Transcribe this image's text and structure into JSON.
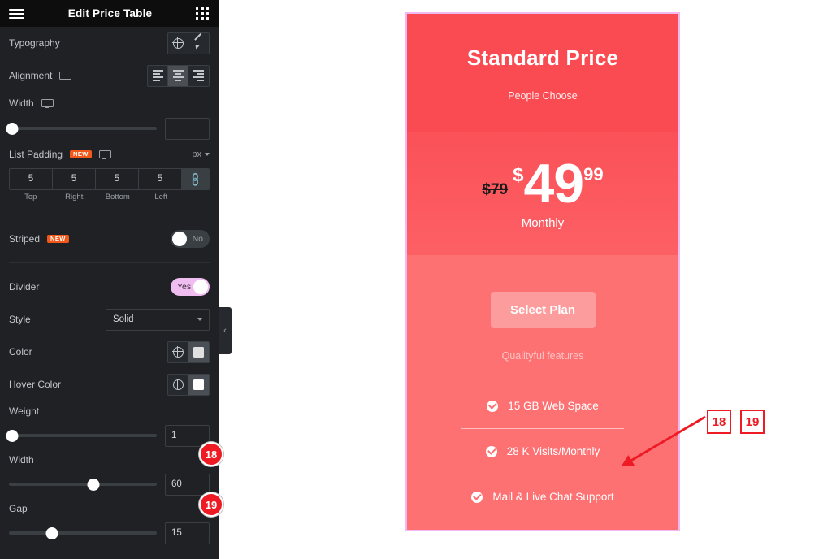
{
  "panel": {
    "header": {
      "title": "Edit Price Table",
      "menu_icon": "hamburger-icon",
      "apps_icon": "grid-dots-icon"
    },
    "typography": {
      "label": "Typography",
      "globe_icon": "globe-icon",
      "edit_icon": "pencil-icon"
    },
    "alignment": {
      "label": "Alignment",
      "device_icon": "desktop-icon",
      "options": [
        "align-left",
        "align-center",
        "align-right"
      ],
      "selected": "align-center"
    },
    "width": {
      "label": "Width",
      "device_icon": "desktop-icon",
      "value": "",
      "slider_percent": 0
    },
    "list_padding": {
      "label": "List Padding",
      "badge": "NEW",
      "device_icon": "desktop-icon",
      "unit": "px",
      "values": [
        "5",
        "5",
        "5",
        "5"
      ],
      "labels": [
        "Top",
        "Right",
        "Bottom",
        "Left"
      ],
      "link_icon": "link-icon",
      "linked": true
    },
    "striped": {
      "label": "Striped",
      "badge": "NEW",
      "state": "No",
      "on": false
    },
    "divider_toggle": {
      "label": "Divider",
      "state": "Yes",
      "on": true
    },
    "style": {
      "label": "Style",
      "value": "Solid",
      "caret_icon": "chevron-down-icon"
    },
    "color": {
      "label": "Color",
      "globe_icon": "globe-icon",
      "swatch": "#e0e0e0"
    },
    "hover_color": {
      "label": "Hover Color",
      "globe_icon": "globe-icon",
      "swatch": "#ffffff"
    },
    "weight": {
      "label": "Weight",
      "value": "1",
      "slider_percent": 0
    },
    "divider_width": {
      "label": "Width",
      "value": "60",
      "slider_percent": 57
    },
    "gap": {
      "label": "Gap",
      "value": "15",
      "slider_percent": 29
    },
    "collapse_tab_icon": "chevron-left-icon"
  },
  "card": {
    "header": {
      "title": "Standard Price",
      "subtitle": "People Choose"
    },
    "price": {
      "original": "$79",
      "currency": "$",
      "integer": "49",
      "fraction": "99",
      "period": "Monthly"
    },
    "cta": {
      "button_label": "Select Plan",
      "note": "Qualityful features"
    },
    "features": [
      {
        "label": "15 GB Web Space",
        "check_icon": "check-circle-icon"
      },
      {
        "label": "28 K Visits/Monthly",
        "check_icon": "check-circle-icon"
      },
      {
        "label": "Mail & Live Chat Support",
        "check_icon": "check-circle-icon"
      }
    ],
    "colors": {
      "header_bg": "#fa4b52",
      "price_bg": "#fb5158",
      "body_bg": "#fd7173",
      "outline": "#f2b8f2"
    }
  },
  "annotations": {
    "circles": [
      {
        "number": "18"
      },
      {
        "number": "19"
      }
    ],
    "boxes": [
      {
        "number": "18"
      },
      {
        "number": "19"
      }
    ],
    "arrow_color": "#ee1b24"
  }
}
